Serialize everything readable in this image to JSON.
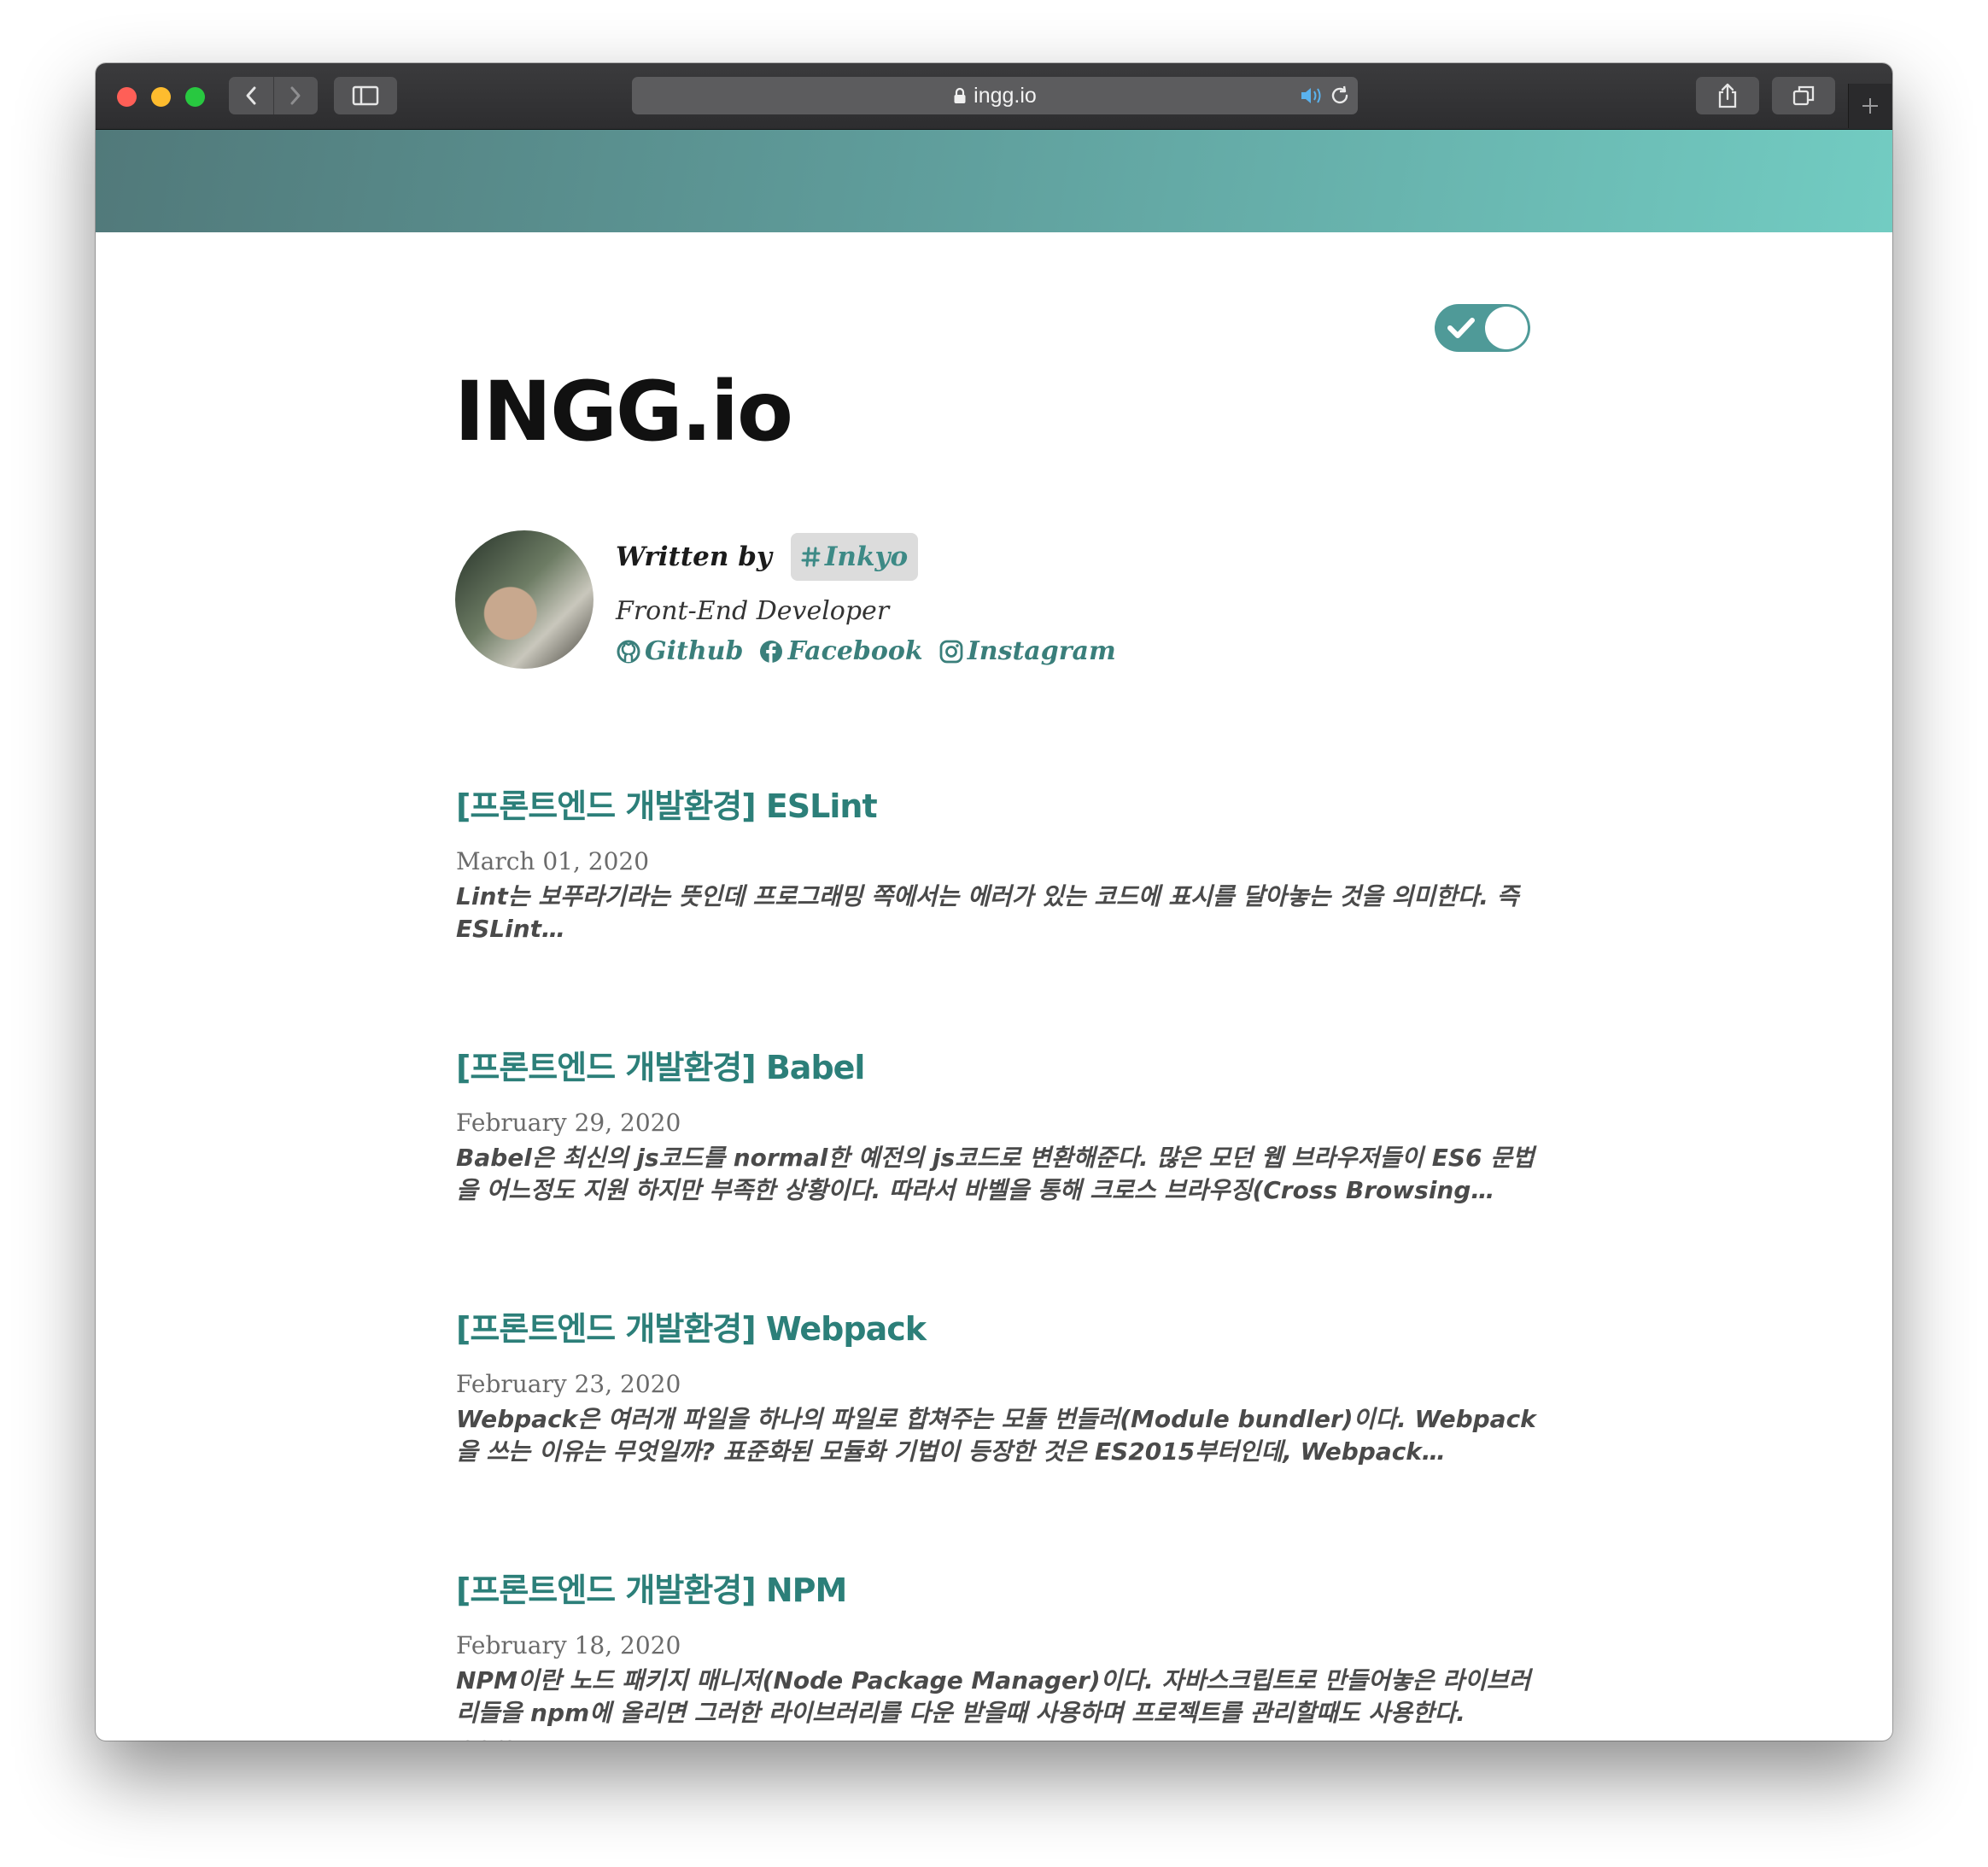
{
  "browser": {
    "url": "ingg.io",
    "icons": {
      "back": "chevron-left-icon",
      "forward": "chevron-right-icon",
      "sidebar": "sidebar-icon",
      "lock": "lock-icon",
      "sound": "speaker-icon",
      "reload": "reload-icon",
      "share": "share-icon",
      "tabs": "tabs-icon",
      "new_tab": "plus-icon"
    }
  },
  "colors": {
    "accent": "#2c7f79",
    "hero_start": "#51797a",
    "hero_end": "#72ccc2",
    "toggle": "#4f9a98"
  },
  "theme_toggle": {
    "on": true
  },
  "site": {
    "title": "INGG.io"
  },
  "bio": {
    "written_by": "Written by",
    "author": "Inkyo",
    "role": "Front-End Developer",
    "links": [
      {
        "label": "Github",
        "icon": "github-icon"
      },
      {
        "label": "Facebook",
        "icon": "facebook-icon"
      },
      {
        "label": "Instagram",
        "icon": "instagram-icon"
      }
    ]
  },
  "posts": [
    {
      "title": "[프론트엔드 개발환경] ESLint",
      "date": "March 01, 2020",
      "excerpt": "Lint는 보푸라기라는 뜻인데 프로그래밍 쪽에서는 에러가 있는 코드에 표시를 달아놓는 것을 의미한다. 즉 ESLint…"
    },
    {
      "title": "[프론트엔드 개발환경] Babel",
      "date": "February 29, 2020",
      "excerpt": "Babel은 최신의 js코드를 normal한 예전의 js코드로 변환해준다. 많은 모던 웹 브라우저들이 ES6 문법을 어느정도 지원 하지만 부족한 상황이다. 따라서 바벨을 통해 크로스 브라우징(Cross Browsing…"
    },
    {
      "title": "[프론트엔드 개발환경] Webpack",
      "date": "February 23, 2020",
      "excerpt": "Webpack은 여러개 파일을 하나의 파일로 합쳐주는 모듈 번들러(Module bundler)이다. Webpack을 쓰는 이유는 무엇일까? 표준화된 모듈화 기법이 등장한 것은 ES2015부터인데, Webpack…"
    },
    {
      "title": "[프론트엔드 개발환경] NPM",
      "date": "February 18, 2020",
      "excerpt": "NPM이란 노드 패키지 매니저(Node Package Manager)이다. 자바스크립트로 만들어놓은 라이브러리들을 npm에 올리면 그러한 라이브러리를 다운 받을때 사용하며 프로젝트를 관리할때도 사용한다. npm…"
    }
  ]
}
